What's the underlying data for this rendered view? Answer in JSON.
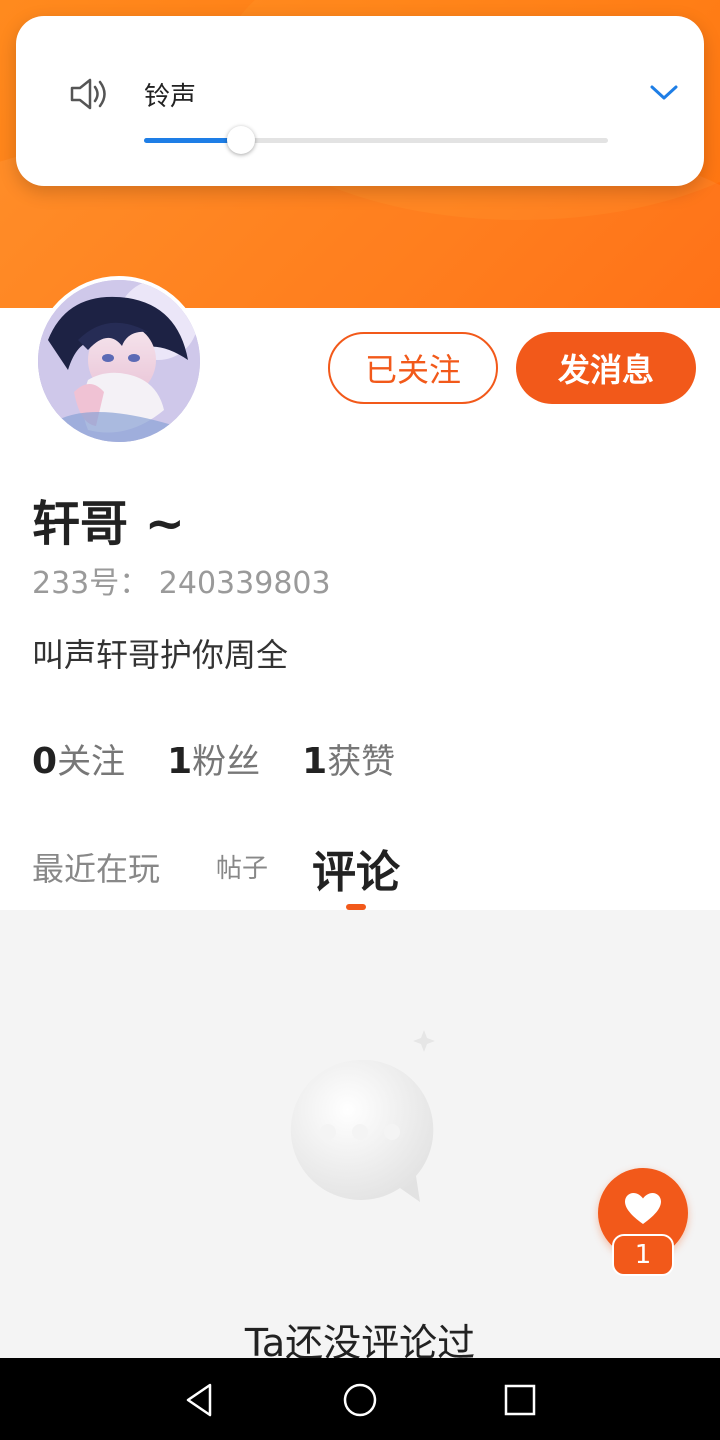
{
  "volume": {
    "label": "铃声",
    "level": 0.21,
    "accent": "#1e7ee6",
    "icon": "speaker-icon"
  },
  "profile": {
    "username": "轩哥 ~",
    "id_line": "233号： 240339803",
    "bio": "叫声轩哥护你周全",
    "followed_label": "已关注",
    "message_label": "发消息"
  },
  "stats": [
    {
      "num": "0",
      "label": "关注"
    },
    {
      "num": "1",
      "label": "粉丝"
    },
    {
      "num": "1",
      "label": "获赞"
    }
  ],
  "tabs": {
    "recent": "最近在玩",
    "posts": "帖子",
    "comments": "评论",
    "active": "comments"
  },
  "empty_state": {
    "message": "Ta还没评论过",
    "icon": "chat-bubble-icon"
  },
  "like_fab": {
    "count": "1",
    "icon": "heart-icon"
  },
  "colors": {
    "brand": "#f2591a",
    "header_orange": "#ff7a12"
  }
}
